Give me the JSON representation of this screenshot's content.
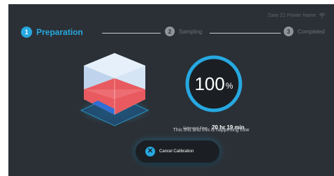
{
  "header": {
    "printer_name": "Zaxe Z1 Printer Name",
    "wifi_icon": "wifi-icon"
  },
  "steps": [
    {
      "number": "1",
      "label": "Preparation",
      "state": "active"
    },
    {
      "number": "2",
      "label": "Sampling",
      "state": "pending"
    },
    {
      "number": "3",
      "label": "Completed",
      "state": "pending"
    }
  ],
  "progress": {
    "value": "100",
    "unit": "%",
    "fraction": 1.0
  },
  "estimate": {
    "label": "Estimated Time",
    "value": "20 hr 19 min"
  },
  "status_message": "This this and this is happening now",
  "cancel_button": {
    "label": "Cancel Calibration",
    "icon": "close-icon"
  },
  "colors": {
    "accent": "#27a8e0",
    "background": "#2b3036",
    "fill_red": "#e85a5f",
    "fill_blue": "#2f6fd6"
  }
}
